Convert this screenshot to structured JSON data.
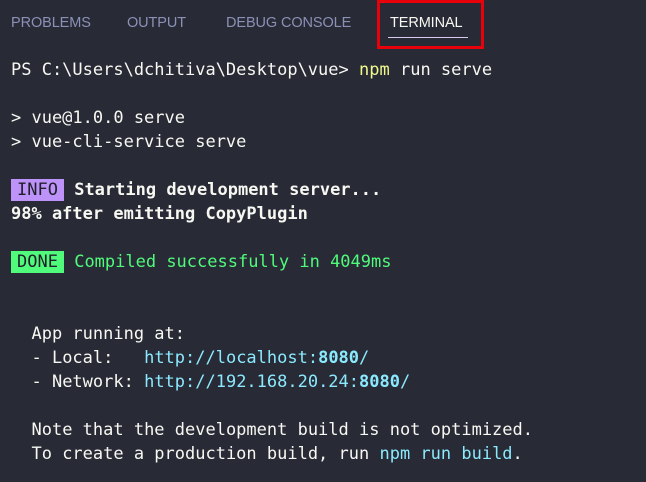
{
  "tabs": {
    "problems": "PROBLEMS",
    "output": "OUTPUT",
    "debug_console": "DEBUG CONSOLE",
    "terminal": "TERMINAL",
    "active": "terminal"
  },
  "terminal": {
    "prompt": "PS C:\\Users\\dchitiva\\Desktop\\vue>",
    "command_bin": "npm",
    "command_args": "run serve",
    "script_line_1": "> vue@1.0.0 serve",
    "script_line_2": "> vue-cli-service serve",
    "info_badge": "INFO",
    "info_text": "Starting development server...",
    "progress_text": "98% after emitting CopyPlugin",
    "done_badge": "DONE",
    "done_text": "Compiled successfully in 4049ms",
    "app_running": "App running at:",
    "local_label": "- Local:   ",
    "local_url_prefix": "http://localhost:",
    "local_port": "8080",
    "local_url_suffix": "/",
    "network_label": "- Network: ",
    "network_url_prefix": "http://192.168.20.24:",
    "network_port": "8080",
    "network_url_suffix": "/",
    "note_line_1": "Note that the development build is not optimized.",
    "note_line_2_prefix": "To create a production build, run ",
    "note_line_2_cmd": "npm run build",
    "note_line_2_suffix": "."
  },
  "colors": {
    "background": "#282a36",
    "highlight_box": "#e8000b",
    "info_badge": "#bd93f9",
    "done_badge": "#50fa7b",
    "url": "#8be9fd",
    "command": "#f1fa8c"
  }
}
